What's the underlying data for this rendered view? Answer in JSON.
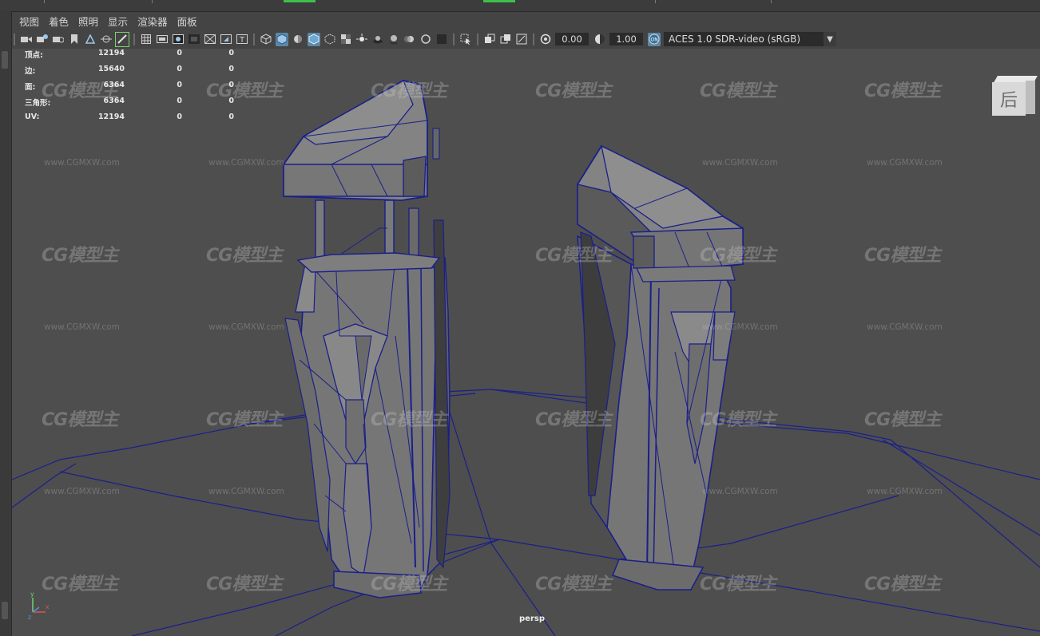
{
  "menu": [
    "视图",
    "着色",
    "照明",
    "显示",
    "渲染器",
    "面板"
  ],
  "toolbar": {
    "gamma_value": "0.00",
    "exposure_value": "1.00",
    "color_space": "ACES 1.0 SDR-video (sRGB)",
    "icons": [
      "camera-icon",
      "camera-attributes-icon",
      "bookmark-icon",
      "image-plane-icon",
      "2d-pan-icon",
      "grease-pencil-icon",
      "grid-icon",
      "film-gate-icon",
      "resolution-gate-icon",
      "gate-mask-icon",
      "field-chart-icon",
      "safe-action-icon",
      "safe-title-icon",
      "wireframe-icon",
      "smooth-shade-icon",
      "default-material-icon",
      "wireframe-on-shaded-icon",
      "xray-icon",
      "xray-joints-icon",
      "use-all-lights-icon",
      "shadows-icon",
      "screen-space-ao-icon",
      "motion-blur-icon",
      "multisample-aa-icon",
      "depth-of-field-icon",
      "isolate-select-icon",
      "select-camera-icon",
      "gamma-icon",
      "exposure-icon",
      "color-management-icon"
    ]
  },
  "hud": {
    "rows": [
      {
        "label": "顶点:",
        "v1": "12194",
        "v2": "0",
        "v3": "0"
      },
      {
        "label": "边:",
        "v1": "15640",
        "v2": "0",
        "v3": "0"
      },
      {
        "label": "面:",
        "v1": "6364",
        "v2": "0",
        "v3": "0"
      },
      {
        "label": "三角形:",
        "v1": "6364",
        "v2": "0",
        "v3": "0"
      },
      {
        "label": "UV:",
        "v1": "12194",
        "v2": "0",
        "v3": "0"
      }
    ]
  },
  "viewcube_label": "后",
  "camera_label": "persp",
  "axis": {
    "y": "y",
    "x": "x",
    "z": "z"
  },
  "watermark": {
    "logo": "CG模型主",
    "url": "www.CGMXW.com"
  },
  "colors": {
    "wire": "#1a1f8a",
    "mesh": "#7a7a7a",
    "viewport_bg": "#4e4e4e",
    "active_icon": "#5d87a7"
  }
}
